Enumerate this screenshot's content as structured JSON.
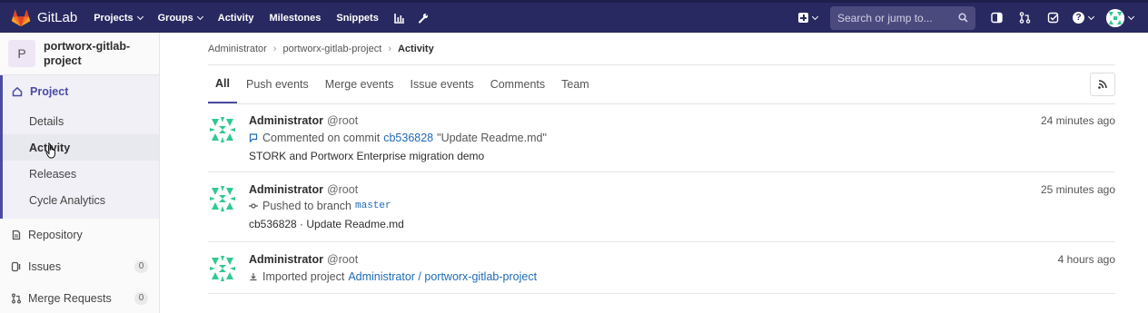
{
  "navbar": {
    "logo_text": "GitLab",
    "links": [
      {
        "label": "Projects",
        "dropdown": true
      },
      {
        "label": "Groups",
        "dropdown": true
      },
      {
        "label": "Activity",
        "dropdown": false
      },
      {
        "label": "Milestones",
        "dropdown": false
      },
      {
        "label": "Snippets",
        "dropdown": false
      }
    ],
    "search_placeholder": "Search or jump to...",
    "help_label": "?"
  },
  "sidebar": {
    "project_initial": "P",
    "project_name": "portworx-gitlab-project",
    "project_section": "Project",
    "project_subitems": [
      {
        "label": "Details"
      },
      {
        "label": "Activity",
        "active": true
      },
      {
        "label": "Releases"
      },
      {
        "label": "Cycle Analytics"
      }
    ],
    "items": [
      {
        "label": "Repository",
        "icon": "repository-icon"
      },
      {
        "label": "Issues",
        "icon": "issues-icon",
        "count": "0"
      },
      {
        "label": "Merge Requests",
        "icon": "merge-request-icon",
        "count": "0"
      }
    ]
  },
  "breadcrumb": [
    "Administrator",
    "portworx-gitlab-project",
    "Activity"
  ],
  "tabs": [
    {
      "label": "All",
      "active": true
    },
    {
      "label": "Push events"
    },
    {
      "label": "Merge events"
    },
    {
      "label": "Issue events"
    },
    {
      "label": "Comments"
    },
    {
      "label": "Team"
    }
  ],
  "events": [
    {
      "author": "Administrator",
      "handle": "@root",
      "time": "24 minutes ago",
      "action": "Commented on commit",
      "target": "cb536828",
      "suffix": "\"Update Readme.md\"",
      "detail": "STORK and Portworx Enterprise migration demo"
    },
    {
      "author": "Administrator",
      "handle": "@root",
      "time": "25 minutes ago",
      "action": "Pushed to branch",
      "target": "master",
      "detail": "cb536828 · Update Readme.md"
    },
    {
      "author": "Administrator",
      "handle": "@root",
      "time": "4 hours ago",
      "action": "Imported project",
      "target": "Administrator / portworx-gitlab-project"
    }
  ],
  "colors": {
    "navbar": "#292961",
    "accent": "#4b4ba3",
    "link": "#1f6bb6",
    "identicon": "#2fca8f"
  }
}
